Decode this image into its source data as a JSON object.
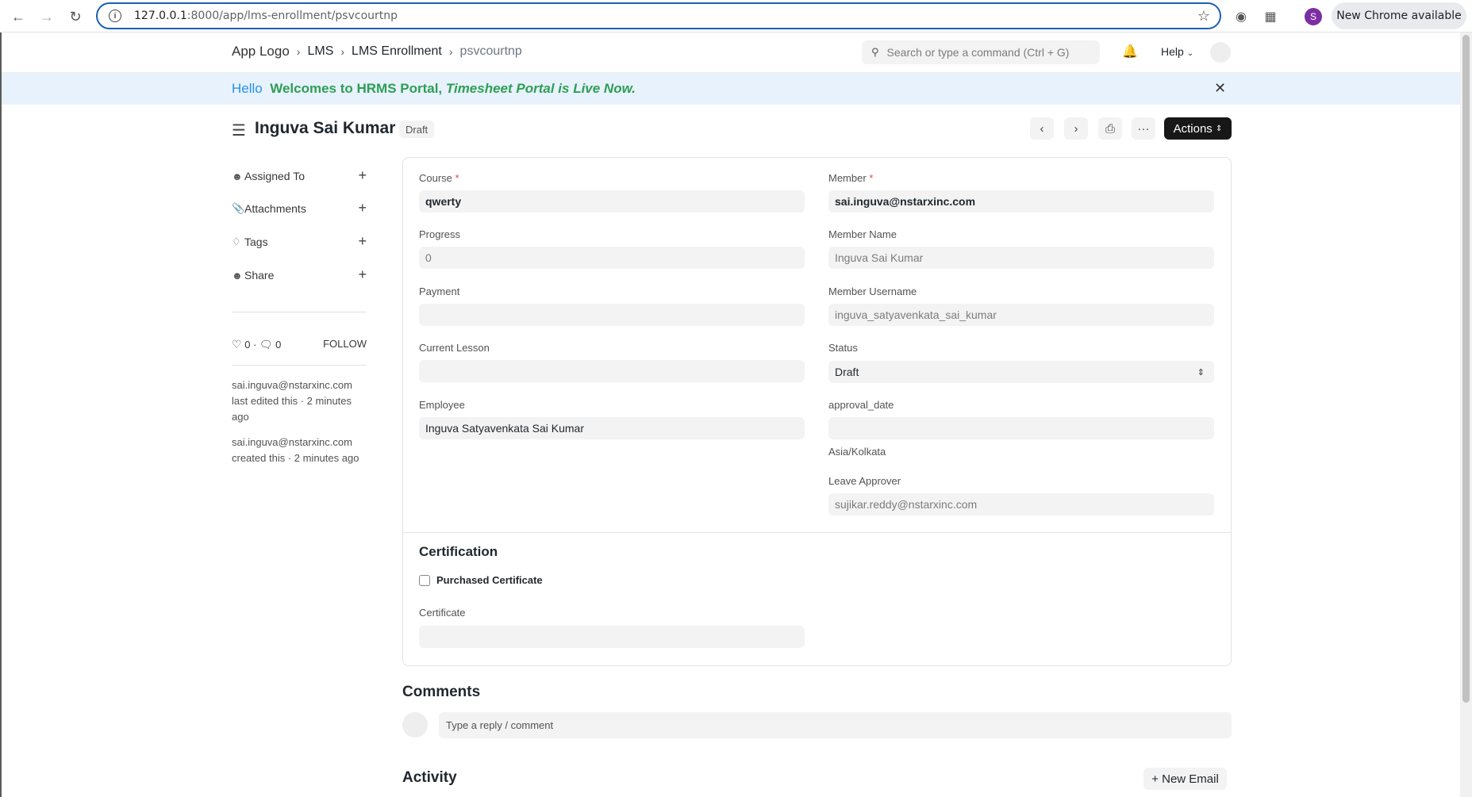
{
  "browser": {
    "url_host": "127.0.0.1",
    "url_path": ":8000/app/lms-enrollment/psvcourtnp",
    "profile_initial": "S",
    "update_label": "New Chrome available"
  },
  "header": {
    "logo_alt": "App Logo",
    "breadcrumbs": [
      "LMS",
      "LMS Enrollment",
      "psvcourtnp"
    ],
    "search_placeholder": "Search or type a command (Ctrl + G)",
    "help_label": "Help"
  },
  "banner": {
    "hello": "Hello",
    "bold_text": "Welcomes to HRMS Portal,",
    "italic_text": "Timesheet Portal is Live Now."
  },
  "page": {
    "title": "Inguva Sai Kumar",
    "status": "Draft",
    "actions_label": "Actions"
  },
  "sidebar": {
    "items": [
      {
        "label": "Assigned To"
      },
      {
        "label": "Attachments"
      },
      {
        "label": "Tags"
      },
      {
        "label": "Share"
      }
    ],
    "likes": "0",
    "comments": "0",
    "follow_label": "FOLLOW",
    "edited_by": "sai.inguva@nstarxinc.com",
    "edited_text": "last edited this · 2 minutes ago",
    "created_by": "sai.inguva@nstarxinc.com",
    "created_text": "created this · 2 minutes ago"
  },
  "form": {
    "course_label": "Course",
    "course_value": "qwerty",
    "member_label": "Member",
    "member_value": "sai.inguva@nstarxinc.com",
    "progress_label": "Progress",
    "progress_value": "0",
    "member_name_label": "Member Name",
    "member_name_value": "Inguva Sai Kumar",
    "payment_label": "Payment",
    "payment_value": "",
    "member_username_label": "Member Username",
    "member_username_value": "inguva_satyavenkata_sai_kumar",
    "current_lesson_label": "Current Lesson",
    "current_lesson_value": "",
    "status_label": "Status",
    "status_value": "Draft",
    "employee_label": "Employee",
    "employee_value": "Inguva Satyavenkata Sai Kumar",
    "approval_date_label": "approval_date",
    "approval_date_value": "",
    "timezone_note": "Asia/Kolkata",
    "leave_approver_label": "Leave Approver",
    "leave_approver_value": "sujikar.reddy@nstarxinc.com",
    "certification_title": "Certification",
    "purchased_certificate_label": "Purchased Certificate",
    "certificate_label": "Certificate",
    "certificate_value": ""
  },
  "comments": {
    "title": "Comments",
    "placeholder": "Type a reply / comment"
  },
  "activity": {
    "title": "Activity",
    "new_email_label": "+ New Email"
  }
}
